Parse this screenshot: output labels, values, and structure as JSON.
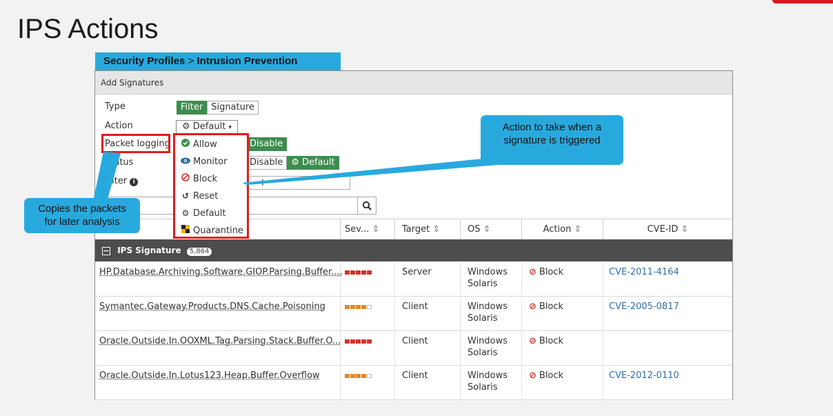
{
  "slide": {
    "title": "IPS Actions"
  },
  "breadcrumb": {
    "part1": "Security Profiles",
    "sep": ">",
    "part2": "Intrusion Prevention"
  },
  "panel": {
    "header": "Add Signatures"
  },
  "form": {
    "type_label": "Type",
    "type_options": [
      "Filter",
      "Signature"
    ],
    "action_label": "Action",
    "action_value": "Default",
    "packet_logging_label": "Packet logging",
    "packet_logging_disable": "Disable",
    "status_label": "Status",
    "status_disable": "Disable",
    "status_default": "Default",
    "filter_label": "Filter",
    "filter_add": "+"
  },
  "dropdown": {
    "items": [
      {
        "label": "Allow",
        "icon": "check-circle-icon"
      },
      {
        "label": "Monitor",
        "icon": "eye-icon"
      },
      {
        "label": "Block",
        "icon": "block-icon"
      },
      {
        "label": "Reset",
        "icon": "reset-icon"
      },
      {
        "label": "Default",
        "icon": "gear-icon"
      },
      {
        "label": "Quarantine",
        "icon": "quarantine-icon"
      }
    ]
  },
  "table": {
    "columns": [
      "Sev...",
      "Target",
      "OS",
      "Action",
      "CVE-ID"
    ],
    "group_label": "IPS Signature",
    "group_count": "5,864",
    "rows": [
      {
        "name": "HP.Database.Archiving.Software.GIOP.Parsing.Buffer....",
        "severity": 5,
        "target": "Server",
        "os1": "Windows",
        "os2": "Solaris",
        "action": "Block",
        "cve": "CVE-2011-4164"
      },
      {
        "name": "Symantec.Gateway.Products.DNS.Cache.Poisoning",
        "severity": 4,
        "target": "Client",
        "os1": "Windows",
        "os2": "Solaris",
        "action": "Block",
        "cve": "CVE-2005-0817"
      },
      {
        "name": "Oracle.Outside.In.OOXML.Tag.Parsing.Stack.Buffer.O...",
        "severity": 5,
        "target": "Client",
        "os1": "Windows",
        "os2": "Solaris",
        "action": "Block",
        "cve": ""
      },
      {
        "name": "Oracle.Outside.In.Lotus123.Heap.Buffer.Overflow",
        "severity": 4,
        "target": "Client",
        "os1": "Windows",
        "os2": "Solaris",
        "action": "Block",
        "cve": "CVE-2012-0110"
      }
    ]
  },
  "callouts": {
    "left_line1": "Copies the packets",
    "left_line2": "for later analysis",
    "right_line1": "Action to take when a",
    "right_line2": "signature is triggered"
  },
  "colors": {
    "accent": "#28a9de",
    "highlight": "#e01b1b",
    "green": "#3d8d4f",
    "sev_high": "#d0322e",
    "sev_med": "#e08a2c"
  }
}
